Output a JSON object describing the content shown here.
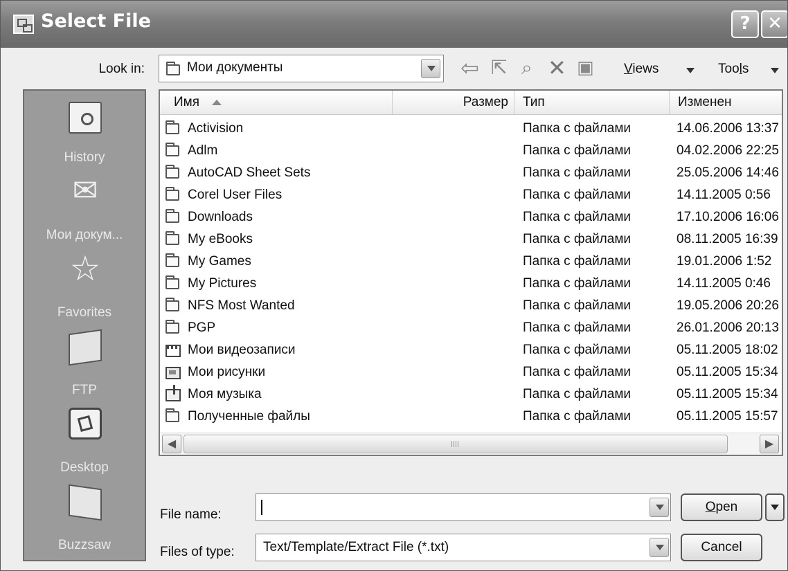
{
  "window": {
    "title": "Select File",
    "help_label": "?",
    "close_label": "✕"
  },
  "look_in": {
    "label": "Look in:",
    "value": "Мои документы"
  },
  "toolbar": {
    "views_prefix": "",
    "views_underlined": "V",
    "views_rest": "iews",
    "tools_prefix": "Too",
    "tools_underlined": "l",
    "tools_rest": "s"
  },
  "places": [
    {
      "label": "History",
      "icon": "history-icon"
    },
    {
      "label": "Мои докум...",
      "icon": "my-documents-icon"
    },
    {
      "label": "Favorites",
      "icon": "favorites-icon"
    },
    {
      "label": "FTP",
      "icon": "ftp-icon"
    },
    {
      "label": "Desktop",
      "icon": "desktop-icon"
    },
    {
      "label": "Buzzsaw",
      "icon": "buzzsaw-icon"
    }
  ],
  "columns": {
    "name": "Имя",
    "size": "Размер",
    "type": "Тип",
    "modified": "Изменен"
  },
  "files": [
    {
      "name": "Activision",
      "type": "Папка с файлами",
      "modified": "14.06.2006 13:37",
      "icon": "folder-icon"
    },
    {
      "name": "Adlm",
      "type": "Папка с файлами",
      "modified": "04.02.2006 22:25",
      "icon": "folder-icon"
    },
    {
      "name": "AutoCAD Sheet Sets",
      "type": "Папка с файлами",
      "modified": "25.05.2006 14:46",
      "icon": "folder-icon"
    },
    {
      "name": "Corel User Files",
      "type": "Папка с файлами",
      "modified": "14.11.2005 0:56",
      "icon": "folder-icon"
    },
    {
      "name": "Downloads",
      "type": "Папка с файлами",
      "modified": "17.10.2006 16:06",
      "icon": "folder-icon"
    },
    {
      "name": "My eBooks",
      "type": "Папка с файлами",
      "modified": "08.11.2005 16:39",
      "icon": "folder-icon"
    },
    {
      "name": "My Games",
      "type": "Папка с файлами",
      "modified": "19.01.2006 1:52",
      "icon": "folder-icon"
    },
    {
      "name": "My Pictures",
      "type": "Папка с файлами",
      "modified": "14.11.2005 0:46",
      "icon": "folder-icon"
    },
    {
      "name": "NFS Most Wanted",
      "type": "Папка с файлами",
      "modified": "19.05.2006 20:26",
      "icon": "folder-icon"
    },
    {
      "name": "PGP",
      "type": "Папка с файлами",
      "modified": "26.01.2006 20:13",
      "icon": "folder-icon"
    },
    {
      "name": "Мои видеозаписи",
      "type": "Папка с файлами",
      "modified": "05.11.2005 18:02",
      "icon": "video-folder-icon"
    },
    {
      "name": "Мои рисунки",
      "type": "Папка с файлами",
      "modified": "05.11.2005 15:34",
      "icon": "pictures-folder-icon"
    },
    {
      "name": "Моя музыка",
      "type": "Папка с файлами",
      "modified": "05.11.2005 15:34",
      "icon": "music-folder-icon"
    },
    {
      "name": "Полученные файлы",
      "type": "Папка с файлами",
      "modified": "05.11.2005 15:57",
      "icon": "folder-icon"
    }
  ],
  "file_name": {
    "label": "File name:",
    "value": ""
  },
  "file_type": {
    "label": "Files of type:",
    "value": "Text/Template/Extract File (*.txt)"
  },
  "buttons": {
    "open_underlined": "O",
    "open_rest": "pen",
    "cancel": "Cancel"
  }
}
